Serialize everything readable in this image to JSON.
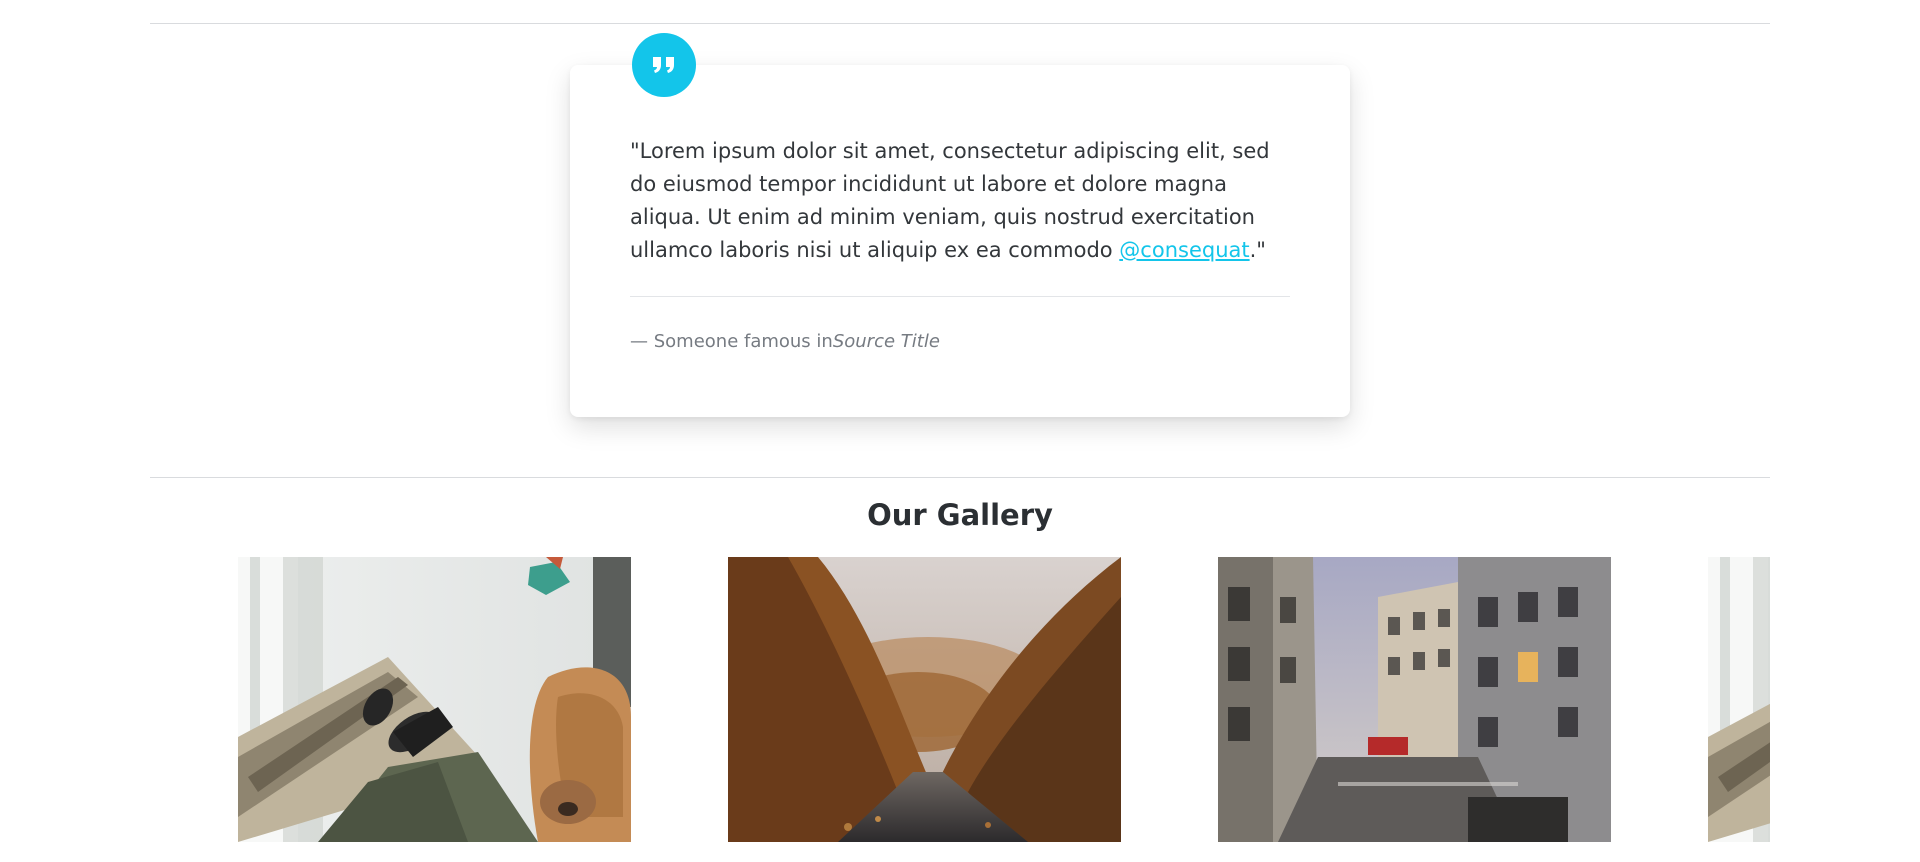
{
  "quote": {
    "icon": "quote-icon",
    "text_before": "\"Lorem ipsum dolor sit amet, consectetur adipiscing elit, sed do eiusmod tempor incididunt ut labore et dolore magna aliqua. Ut enim ad minim veniam, quis nostrud exercitation ullamco laboris nisi ut aliquip ex ea commodo ",
    "link_text": "@consequat",
    "text_after": ".\"",
    "footer_prefix": "— Someone famous in",
    "source_title": "Source Title"
  },
  "gallery": {
    "title": "Our Gallery"
  },
  "colors": {
    "accent": "#13c5ea",
    "text": "#2b2f33",
    "muted": "#767b82"
  }
}
